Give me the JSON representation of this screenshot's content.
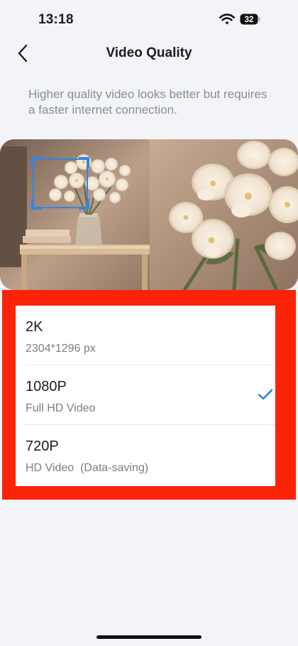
{
  "status_bar": {
    "time": "13:18",
    "battery_level": "32",
    "wifi_icon": "wifi-icon",
    "battery_icon": "battery-icon"
  },
  "nav": {
    "title": "Video Quality",
    "back_icon": "chevron-left-icon"
  },
  "description": "Higher quality video looks better but requires a faster internet connection.",
  "preview": {
    "image": "flower-vase-zoom-comparison"
  },
  "options": [
    {
      "title": "2K",
      "subtitle": "2304*1296 px",
      "selected": false
    },
    {
      "title": "1080P",
      "subtitle": "Full HD Video",
      "selected": true
    },
    {
      "title": "720P",
      "subtitle": "HD Video  (Data-saving)",
      "selected": false
    }
  ],
  "colors": {
    "background": "#f3f4f8",
    "accent": "#1a82e0",
    "highlight": "#fb2308",
    "secondary_text": "#7b7e86"
  }
}
